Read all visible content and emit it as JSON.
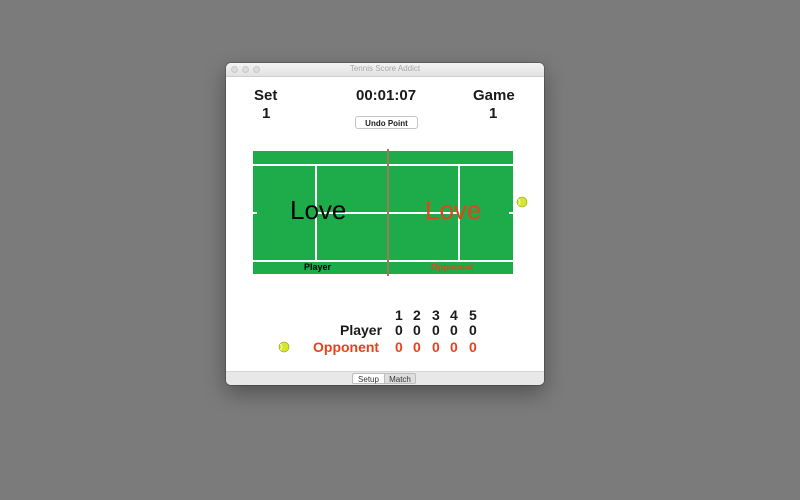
{
  "window": {
    "title": "Tennis Score Addict"
  },
  "header": {
    "set_label": "Set",
    "set_value": "1",
    "timer": "00:01:07",
    "game_label": "Game",
    "game_value": "1",
    "undo_label": "Undo Point"
  },
  "court": {
    "player_score": "Love",
    "opponent_score": "Love",
    "player_label": "Player",
    "opponent_label": "Opponent",
    "court_color": "#1eab4a",
    "opponent_color": "#e8411e",
    "serving": "opponent"
  },
  "scoreboard": {
    "sets": [
      "1",
      "2",
      "3",
      "4",
      "5"
    ],
    "player_label": "Player",
    "opponent_label": "Opponent",
    "player_games": [
      "0",
      "0",
      "0",
      "0",
      "0"
    ],
    "opponent_games": [
      "0",
      "0",
      "0",
      "0",
      "0"
    ]
  },
  "tabs": {
    "setup": "Setup",
    "match": "Match",
    "selected": "Setup"
  }
}
